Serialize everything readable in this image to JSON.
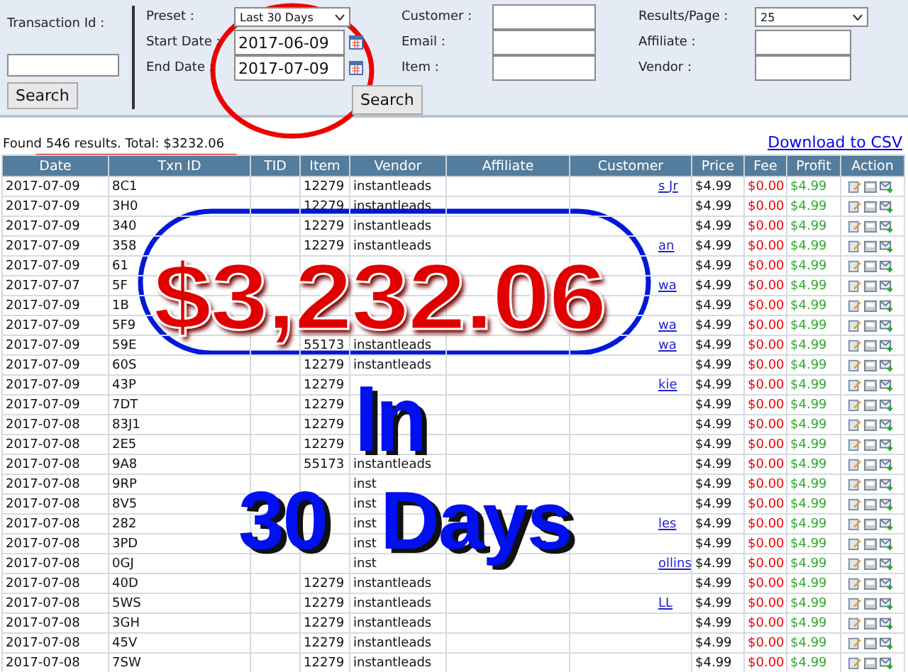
{
  "filters": {
    "transaction_id": {
      "label": "Transaction Id :",
      "button": "Search"
    },
    "preset": {
      "label": "Preset :",
      "value": "Last 30 Days"
    },
    "start_date": {
      "label": "Start Date :",
      "value": "2017-06-09"
    },
    "end_date": {
      "label": "End Date :",
      "value": "2017-07-09"
    },
    "search_button": "Search",
    "customer": {
      "label": "Customer :"
    },
    "email": {
      "label": "Email :"
    },
    "item": {
      "label": "Item :"
    },
    "results_per_page": {
      "label": "Results/Page :",
      "value": "25"
    },
    "affiliate": {
      "label": "Affiliate :"
    },
    "vendor": {
      "label": "Vendor :"
    }
  },
  "summary": {
    "text": "Found 546 results. Total: $3232.06",
    "download_link": "Download to CSV"
  },
  "table": {
    "columns": [
      "Date",
      "Txn ID",
      "TID",
      "Item",
      "Vendor",
      "Affiliate",
      "Customer",
      "Price",
      "Fee",
      "Profit",
      "Action"
    ],
    "rows": [
      {
        "date": "2017-07-09",
        "txn_id": "8C1",
        "item": "12279",
        "vendor": "instantleads",
        "customer": "s Jr",
        "price": "$4.99",
        "fee": "$0.00",
        "profit": "$4.99"
      },
      {
        "date": "2017-07-09",
        "txn_id": "3H0",
        "item": "12279",
        "vendor": "instantleads",
        "price": "$4.99",
        "fee": "$0.00",
        "profit": "$4.99"
      },
      {
        "date": "2017-07-09",
        "txn_id": "340",
        "item": "12279",
        "vendor": "instantleads",
        "price": "$4.99",
        "fee": "$0.00",
        "profit": "$4.99"
      },
      {
        "date": "2017-07-09",
        "txn_id": "358",
        "item": "12279",
        "vendor": "instantleads",
        "customer": "an",
        "price": "$4.99",
        "fee": "$0.00",
        "profit": "$4.99"
      },
      {
        "date": "2017-07-09",
        "txn_id": "61",
        "price": "$4.99",
        "fee": "$0.00",
        "profit": "$4.99"
      },
      {
        "date": "2017-07-07",
        "txn_id": "5F",
        "customer": "wa",
        "price": "$4.99",
        "fee": "$0.00",
        "profit": "$4.99"
      },
      {
        "date": "2017-07-09",
        "txn_id": "1B",
        "price": "$4.99",
        "fee": "$0.00",
        "profit": "$4.99"
      },
      {
        "date": "2017-07-09",
        "txn_id": "5F9",
        "customer": "wa",
        "price": "$4.99",
        "fee": "$0.00",
        "profit": "$4.99"
      },
      {
        "date": "2017-07-09",
        "txn_id": "59E",
        "item": "55173",
        "vendor": "instantleads",
        "customer": "wa",
        "price": "$4.99",
        "fee": "$0.00",
        "profit": "$4.99"
      },
      {
        "date": "2017-07-09",
        "txn_id": "60S",
        "item": "12279",
        "vendor": "instantleads",
        "price": "$4.99",
        "fee": "$0.00",
        "profit": "$4.99"
      },
      {
        "date": "2017-07-09",
        "txn_id": "43P",
        "item": "12279",
        "customer": "kie",
        "price": "$4.99",
        "fee": "$0.00",
        "profit": "$4.99"
      },
      {
        "date": "2017-07-09",
        "txn_id": "7DT",
        "item": "12279",
        "price": "$4.99",
        "fee": "$0.00",
        "profit": "$4.99"
      },
      {
        "date": "2017-07-08",
        "txn_id": "83J1",
        "item": "12279",
        "price": "$4.99",
        "fee": "$0.00",
        "profit": "$4.99"
      },
      {
        "date": "2017-07-08",
        "txn_id": "2E5",
        "item": "12279",
        "price": "$4.99",
        "fee": "$0.00",
        "profit": "$4.99"
      },
      {
        "date": "2017-07-08",
        "txn_id": "9A8",
        "item": "55173",
        "vendor": "instantleads",
        "price": "$4.99",
        "fee": "$0.00",
        "profit": "$4.99"
      },
      {
        "date": "2017-07-08",
        "txn_id": "9RP",
        "vendor": "inst",
        "price": "$4.99",
        "fee": "$0.00",
        "profit": "$4.99"
      },
      {
        "date": "2017-07-08",
        "txn_id": "8V5",
        "vendor": "inst",
        "price": "$4.99",
        "fee": "$0.00",
        "profit": "$4.99"
      },
      {
        "date": "2017-07-08",
        "txn_id": "282",
        "vendor": "inst",
        "customer": "les",
        "price": "$4.99",
        "fee": "$0.00",
        "profit": "$4.99"
      },
      {
        "date": "2017-07-08",
        "txn_id": "3PD",
        "vendor": "inst",
        "price": "$4.99",
        "fee": "$0.00",
        "profit": "$4.99"
      },
      {
        "date": "2017-07-08",
        "txn_id": "0GJ",
        "vendor": "inst",
        "customer": "ollins",
        "price": "$4.99",
        "fee": "$0.00",
        "profit": "$4.99"
      },
      {
        "date": "2017-07-08",
        "txn_id": "40D",
        "item": "12279",
        "vendor": "instantleads",
        "price": "$4.99",
        "fee": "$0.00",
        "profit": "$4.99"
      },
      {
        "date": "2017-07-08",
        "txn_id": "5WS",
        "item": "12279",
        "vendor": "instantleads",
        "customer": "LL",
        "price": "$4.99",
        "fee": "$0.00",
        "profit": "$4.99"
      },
      {
        "date": "2017-07-08",
        "txn_id": "3GH",
        "item": "12279",
        "vendor": "instantleads",
        "price": "$4.99",
        "fee": "$0.00",
        "profit": "$4.99"
      },
      {
        "date": "2017-07-08",
        "txn_id": "45V",
        "item": "12279",
        "vendor": "instantleads",
        "price": "$4.99",
        "fee": "$0.00",
        "profit": "$4.99"
      },
      {
        "date": "2017-07-08",
        "txn_id": "7SW",
        "item": "12279",
        "vendor": "instantleads",
        "price": "$4.99",
        "fee": "$0.00",
        "profit": "$4.99"
      }
    ]
  },
  "annotations": [
    {
      "kind": "amount",
      "text": "$3,232.06"
    },
    {
      "kind": "caption",
      "text": "In"
    },
    {
      "kind": "caption",
      "text": "30"
    },
    {
      "kind": "caption",
      "text": "Days"
    }
  ]
}
